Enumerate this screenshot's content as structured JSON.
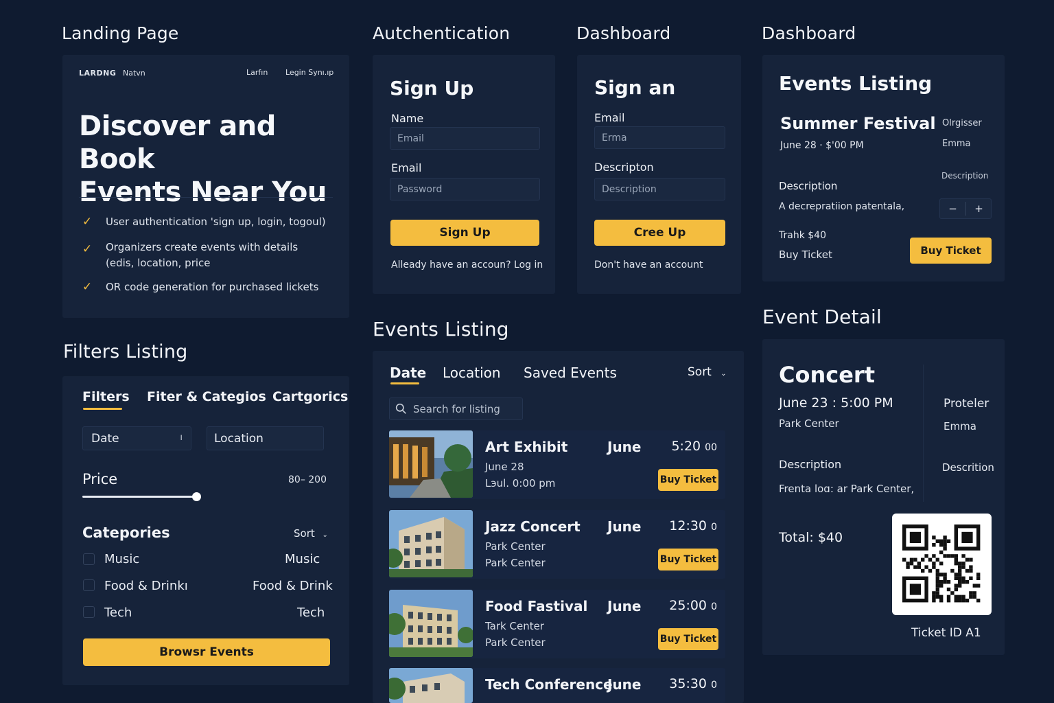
{
  "sections": {
    "landing": "Landing Page",
    "auth": "Autchentication",
    "dashboard1": "Dashboard",
    "dashboard2": "Dashboard",
    "filters": "Filters Listing",
    "events": "Events Listing",
    "detail": "Event Detail"
  },
  "landing": {
    "nav": {
      "brand": "LARDNG",
      "link": "Natvn",
      "login": "Larfın",
      "signup": "Legin Synı.ıp"
    },
    "hero_line1": "Discover and Book",
    "hero_line2": "Events Near You",
    "features": [
      "User authentication 'sign up, login, togoul)",
      "Organizers create events with details",
      "(edis, location, price",
      "OR code generation for purchased lickets"
    ]
  },
  "signup": {
    "title": "Sign Up",
    "name_label": "Name",
    "name_placeholder": "Email",
    "email_label": "Email",
    "email_placeholder": "Password",
    "button": "Sign Up",
    "footer": "Alleady have an accoun? Log in"
  },
  "signin": {
    "title": "Sign an",
    "email_label": "Email",
    "email_placeholder": "Erma",
    "desc_label": "Descripton",
    "desc_placeholder": "Description",
    "button": "Cree Up",
    "footer": "Don't have an account"
  },
  "events_card": {
    "title": "Events Listing",
    "event_name": "Summer Festival",
    "event_date": "June 28 · $'00 PM",
    "org_label": "Olrgisser",
    "org_name": "Emma",
    "desc_right": "Description",
    "desc_label": "Description",
    "desc_text": "A decrepratiion patentala,",
    "minus": "−",
    "plus": "+",
    "price": "Trahk $40",
    "buy_text": "Buy Ticket",
    "buy_button": "Buy Ticket"
  },
  "filters": {
    "tabs": [
      "Filters",
      "Fiter & Categios",
      "Cartgorics"
    ],
    "date_label": "Date",
    "date_caret": "ı",
    "location_label": "Location",
    "price_label": "Price",
    "price_range": "80– 200",
    "price_fraction": 0.46,
    "categories_label": "Catepories",
    "sort_label": "Sort",
    "categories": [
      {
        "left": "Music",
        "right": "Music"
      },
      {
        "left": "Food & Drinkı",
        "right": "Food & Drink"
      },
      {
        "left": "Tech",
        "right": "Tech"
      }
    ],
    "browse_button": "Browsr Events"
  },
  "listing": {
    "tabs": [
      "Date",
      "Location",
      "Saved Events"
    ],
    "sort_label": "Sort",
    "search_placeholder": "Search for listing",
    "events": [
      {
        "title": "Art Exhibit",
        "month": "June",
        "time": "5:20",
        "time_suffix": "00",
        "line1": "June 28",
        "line2": "Lэul. 0:00 pm",
        "button": "Buy Ticket"
      },
      {
        "title": "Jazz Concert",
        "month": "June",
        "time": "12:30",
        "time_suffix": "0",
        "line1": "Park Center",
        "line2": "Park Center",
        "button": "Buy Ticket"
      },
      {
        "title": "Food Fastival",
        "month": "June",
        "time": "25:00",
        "time_suffix": "0",
        "line1": "Tark Center",
        "line2": "Park Center",
        "button": "Buy Ticket"
      },
      {
        "title": "Tech Conference",
        "month": "June",
        "time": "35:30",
        "time_suffix": "0",
        "line1": "",
        "line2": "",
        "button": ""
      }
    ]
  },
  "detail": {
    "title": "Concert",
    "datetime": "June 23 : 5:00 PM",
    "venue": "Park Center",
    "org_label": "Proteler",
    "org_name": "Emma",
    "desc_label": "Description",
    "desc_right": "Descrition",
    "desc_text": "Frenta loɑ: ar Park Center,",
    "total": "Total: $40",
    "ticket_id": "Ticket ID A1"
  },
  "colors": {
    "background": "#0f1b30",
    "panel": "#16233a",
    "accent": "#f4bd3f"
  },
  "icons": [
    "check-icon",
    "search-icon",
    "chevron-down-icon",
    "qr-code-icon"
  ]
}
